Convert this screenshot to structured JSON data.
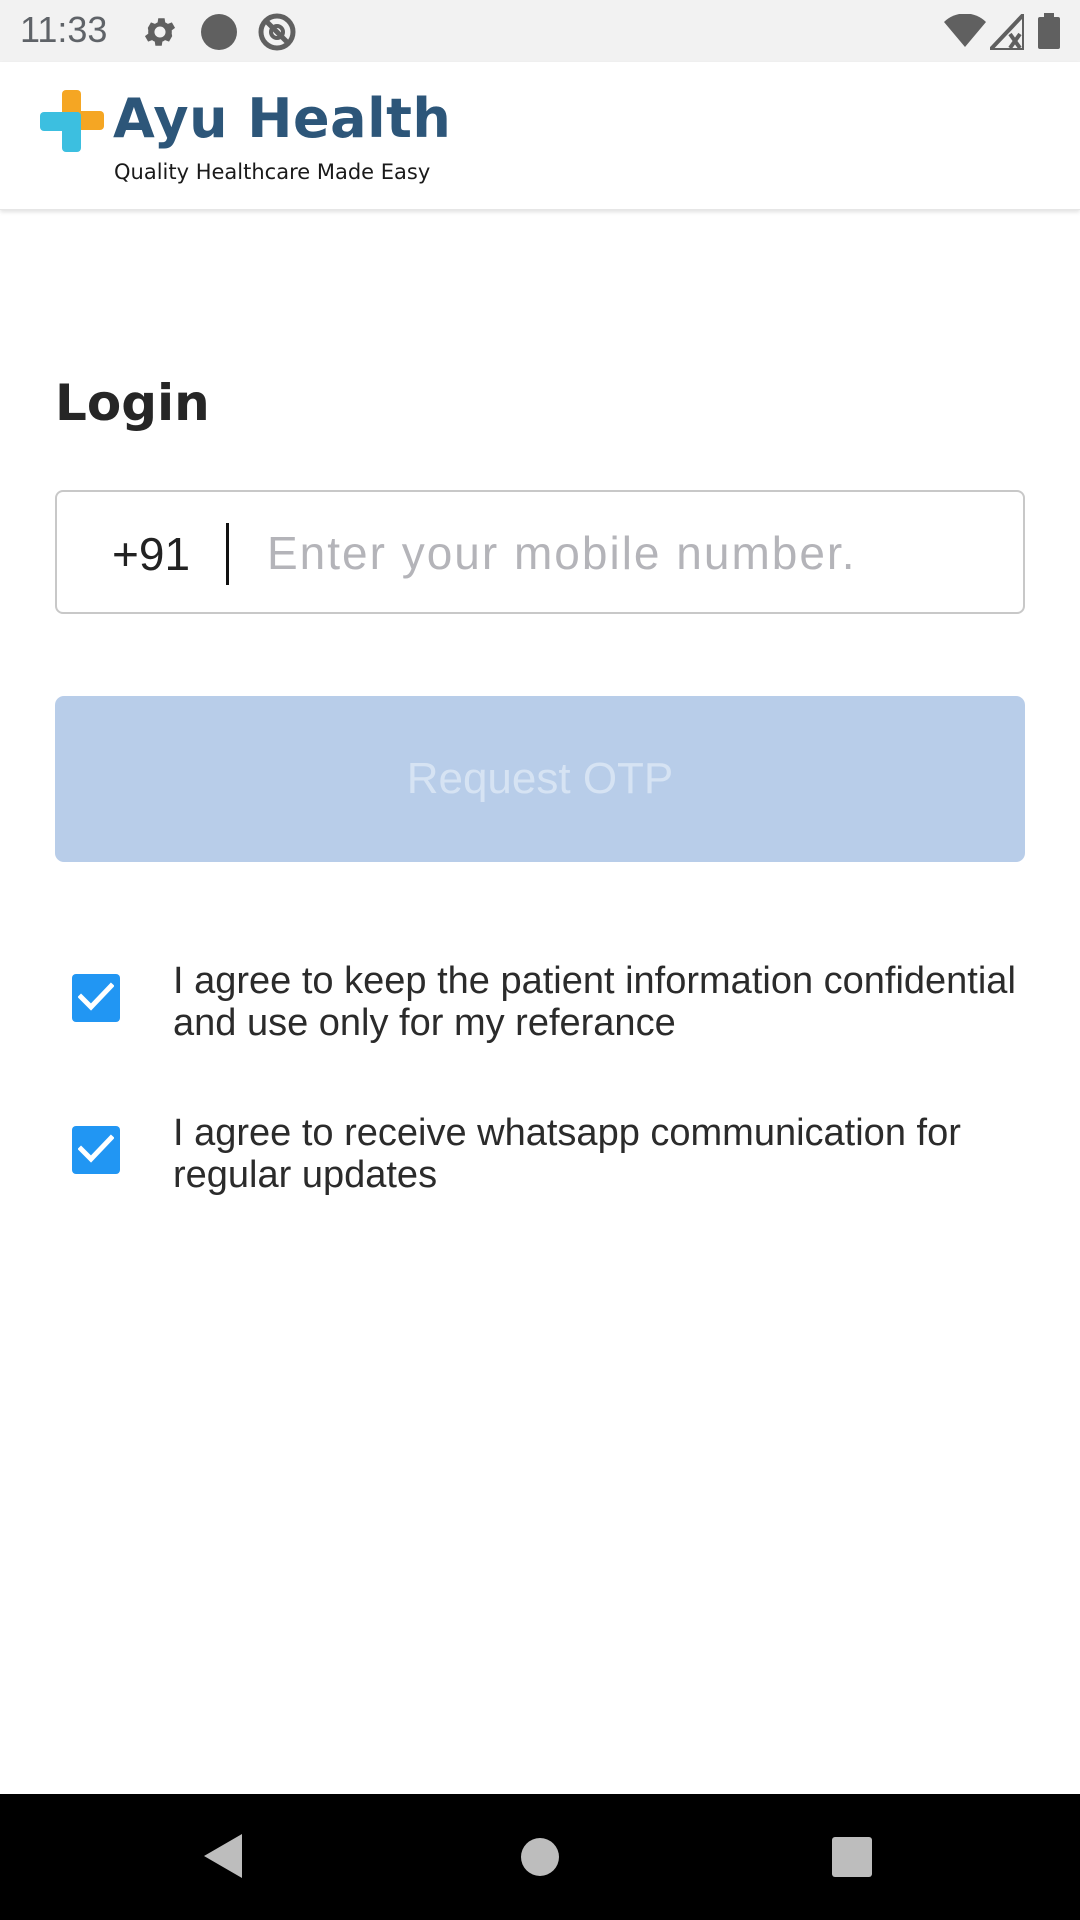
{
  "status_bar": {
    "time": "11:33",
    "icons": [
      "settings-gear-icon",
      "record-dot-icon",
      "do-not-disturb-icon",
      "wifi-icon",
      "cell-signal-icon",
      "battery-icon"
    ]
  },
  "header": {
    "brand_name": "Ayu Health",
    "tagline": "Quality Healthcare Made Easy",
    "logo_colors": {
      "orange": "#f5a623",
      "cyan": "#3cbfe0"
    },
    "brand_color": "#2d5679"
  },
  "login": {
    "title": "Login",
    "country_code": "+91",
    "phone_value": "",
    "phone_placeholder": "Enter your mobile number.",
    "request_otp_label": "Request OTP",
    "request_otp_enabled": false
  },
  "consents": [
    {
      "checked": true,
      "text": "I agree to keep the patient information confidential and use only for my referance"
    },
    {
      "checked": true,
      "text": "I agree to receive whatsapp communication for regular updates"
    }
  ],
  "nav_bar": {
    "buttons": [
      "back-icon",
      "home-icon",
      "recents-icon"
    ]
  },
  "colors": {
    "checkbox": "#2196f3",
    "button_disabled_bg": "#b8cde9",
    "button_disabled_text": "#d6e3f3"
  }
}
